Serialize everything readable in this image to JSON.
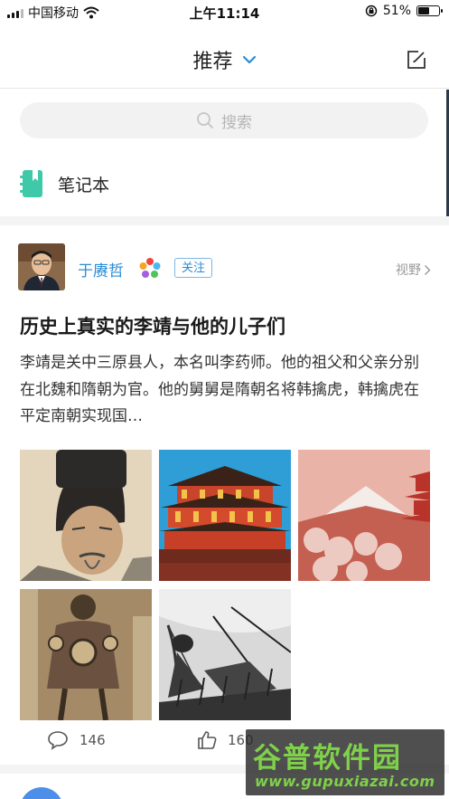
{
  "status_bar": {
    "carrier": "中国移动",
    "time": "上午11:14",
    "battery": "51%",
    "battery_level": 0.51
  },
  "nav": {
    "title": "推荐",
    "dropdown_icon": "chevron-down-icon",
    "edit_icon": "compose-icon"
  },
  "search": {
    "placeholder": "搜索"
  },
  "notebook": {
    "label": "笔记本",
    "icon": "notebook-icon"
  },
  "card": {
    "author": "于赓哲",
    "follow_label": "关注",
    "category": "视野",
    "title": "历史上真实的李靖与他的儿子们",
    "summary": "李靖是关中三原县人，本名叫李药师。他的祖父和父亲分别在北魏和隋朝为官。他的舅舅是隋朝名将韩擒虎，韩擒虎在平定南朝实现国…",
    "images": [
      "portrait-painting",
      "palace-building",
      "mount-fuji-pagoda",
      "mural-fresco",
      "battle-sketch"
    ],
    "comment_count": "146",
    "like_count": "160"
  },
  "watermark": {
    "main": "谷普软件园",
    "sub": "www.gupuxiazai.com"
  },
  "colors": {
    "accent": "#2b8cd6",
    "notebook_icon": "#3fc9a8",
    "watermark_green": "#7fd14a"
  }
}
